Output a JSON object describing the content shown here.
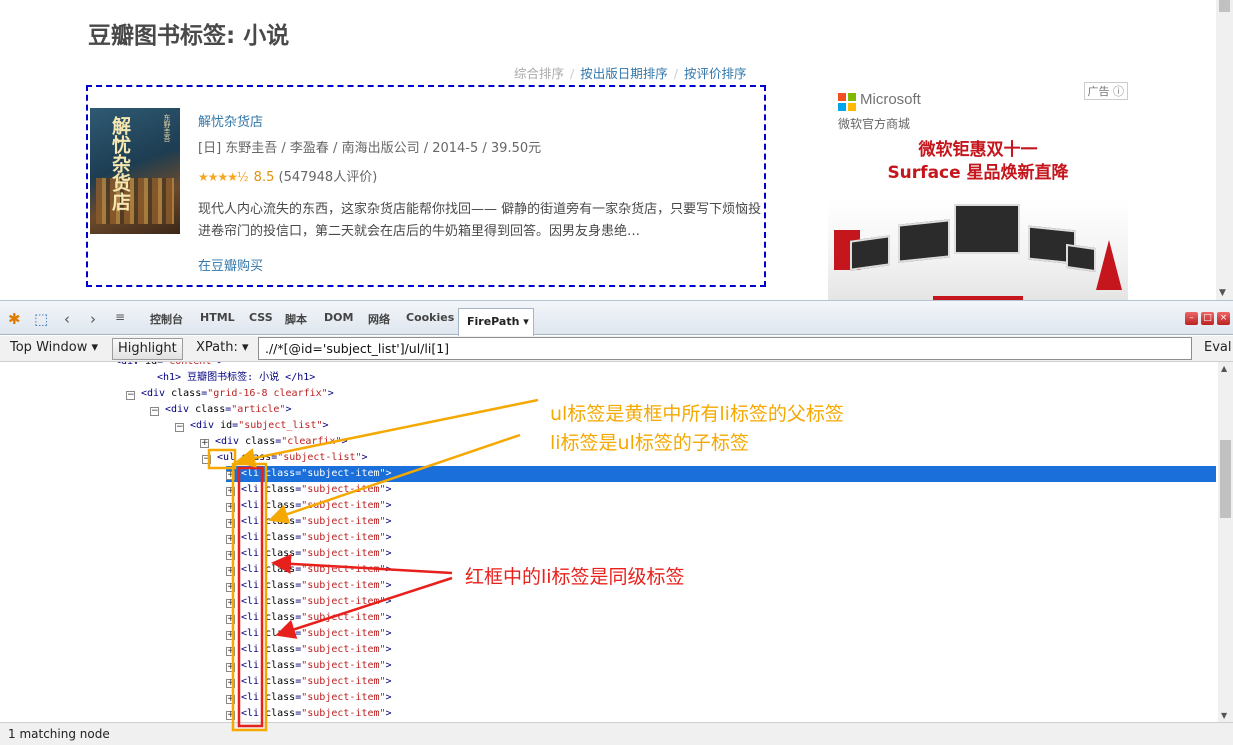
{
  "page": {
    "title": "豆瓣图书标签: 小说",
    "sort": {
      "default": "综合排序",
      "by_date": "按出版日期排序",
      "by_rating": "按评价排序"
    },
    "book": {
      "cover_title": "解忧杂货店",
      "cover_author": "东野圭吾",
      "title": "解忧杂货店",
      "meta": "[日] 东野圭吾 / 李盈春 / 南海出版公司 / 2014-5 / 39.50元",
      "stars": "★★★★½",
      "stars_value": 4.5,
      "rating": "8.5",
      "rating_count": "(547948人评价)",
      "desc": "现代人内心流失的东西，这家杂货店能帮你找回—— 僻静的街道旁有一家杂货店，只要写下烦恼投进卷帘门的投信口，第二天就会在店后的牛奶箱里得到回答。因男友身患绝…",
      "buy": "在豆瓣购买"
    },
    "ad": {
      "tag": "广告",
      "brand": "Microsoft",
      "store": "微软官方商城",
      "line1": "微软钜惠双十一",
      "line2": "Surface 星品焕新直降"
    }
  },
  "devtools": {
    "tabs": [
      "控制台",
      "HTML",
      "CSS",
      "脚本",
      "DOM",
      "网络",
      "Cookies"
    ],
    "active_tab": "FirePath ▾",
    "toolbar": {
      "top_window": "Top Window ▾",
      "highlight": "Highlight",
      "xpath_label": "XPath: ▾",
      "xpath_value": ".//*[@id='subject_list']/ul/li[1]",
      "eval": "Eval"
    },
    "tree": [
      {
        "toggle": "",
        "tag": "<div",
        "attr": "id",
        "val": "\"content\"",
        "end": ">"
      },
      {
        "toggle": "",
        "tag": "<h1>",
        "attr": "",
        "val": "",
        "end": "豆瓣图书标签: 小说 </h1>"
      },
      {
        "toggle": "⊟",
        "tag": "<div",
        "attr": "class",
        "val": "\"grid-16-8 clearfix\"",
        "end": ">"
      },
      {
        "toggle": "⊟",
        "tag": "<div",
        "attr": "class",
        "val": "\"article\"",
        "end": ">"
      },
      {
        "toggle": "⊟",
        "tag": "<div",
        "attr": "id",
        "val": "\"subject_list\"",
        "end": ">"
      },
      {
        "toggle": "⊞",
        "tag": "<div",
        "attr": "class",
        "val": "\"clearfix\"",
        "end": ">"
      },
      {
        "toggle": "⊟",
        "tag": "<ul",
        "attr": "class",
        "val": "\"subject-list\"",
        "end": ">"
      },
      {
        "toggle": "⊞",
        "tag": "<li",
        "attr": "class",
        "val": "\"subject-item\"",
        "end": ">"
      },
      {
        "toggle": "⊞",
        "tag": "<li",
        "attr": "class",
        "val": "\"subject-item\"",
        "end": ">"
      },
      {
        "toggle": "⊞",
        "tag": "<li",
        "attr": "class",
        "val": "\"subject-item\"",
        "end": ">"
      },
      {
        "toggle": "⊞",
        "tag": "<li",
        "attr": "class",
        "val": "\"subject-item\"",
        "end": ">"
      },
      {
        "toggle": "⊞",
        "tag": "<li",
        "attr": "class",
        "val": "\"subject-item\"",
        "end": ">"
      },
      {
        "toggle": "⊞",
        "tag": "<li",
        "attr": "class",
        "val": "\"subject-item\"",
        "end": ">"
      },
      {
        "toggle": "⊞",
        "tag": "<li",
        "attr": "class",
        "val": "\"subject-item\"",
        "end": ">"
      },
      {
        "toggle": "⊞",
        "tag": "<li",
        "attr": "class",
        "val": "\"subject-item\"",
        "end": ">"
      },
      {
        "toggle": "⊞",
        "tag": "<li",
        "attr": "class",
        "val": "\"subject-item\"",
        "end": ">"
      },
      {
        "toggle": "⊞",
        "tag": "<li",
        "attr": "class",
        "val": "\"subject-item\"",
        "end": ">"
      },
      {
        "toggle": "⊞",
        "tag": "<li",
        "attr": "class",
        "val": "\"subject-item\"",
        "end": ">"
      },
      {
        "toggle": "⊞",
        "tag": "<li",
        "attr": "class",
        "val": "\"subject-item\"",
        "end": ">"
      },
      {
        "toggle": "⊞",
        "tag": "<li",
        "attr": "class",
        "val": "\"subject-item\"",
        "end": ">"
      },
      {
        "toggle": "⊞",
        "tag": "<li",
        "attr": "class",
        "val": "\"subject-item\"",
        "end": ">"
      },
      {
        "toggle": "⊞",
        "tag": "<li",
        "attr": "class",
        "val": "\"subject-item\"",
        "end": ">"
      },
      {
        "toggle": "⊞",
        "tag": "<li",
        "attr": "class",
        "val": "\"subject-item\"",
        "end": ">"
      }
    ],
    "selected_row": 7,
    "status": "1 matching node"
  },
  "annotations": {
    "ul_note": "ul标签是黄框中所有li标签的父标签",
    "li_note": "li标签是ul标签的子标签",
    "sibling_note": "红框中的li标签是同级标签",
    "colors": {
      "yellow": "#f5a800",
      "red": "#e8201c",
      "selection": "#1a6fdb",
      "link": "#3377aa"
    }
  }
}
